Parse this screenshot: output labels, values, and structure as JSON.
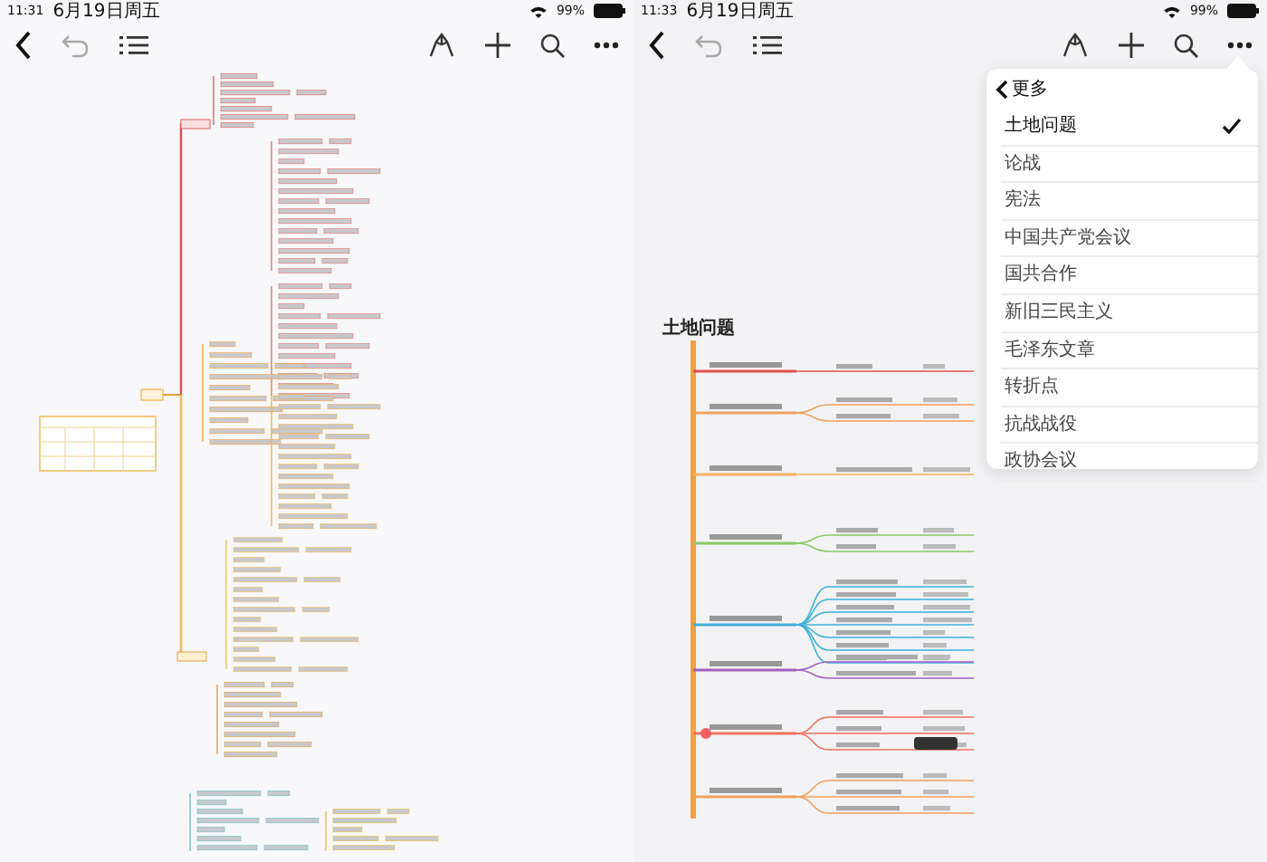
{
  "panes": [
    {
      "status_bar": {
        "time": "11:31",
        "date": "6月19日周五",
        "battery": "99%"
      }
    },
    {
      "status_bar": {
        "time": "11:33",
        "date": "6月19日周五",
        "battery": "99%"
      }
    }
  ],
  "mindmap": {
    "root": "土地问题"
  },
  "menu": {
    "title": "更多",
    "items": [
      {
        "label": "土地问题",
        "selected": true
      },
      {
        "label": "论战",
        "selected": false
      },
      {
        "label": "宪法",
        "selected": false
      },
      {
        "label": "中国共产党会议",
        "selected": false
      },
      {
        "label": "国共合作",
        "selected": false
      },
      {
        "label": "新旧三民主义",
        "selected": false
      },
      {
        "label": "毛泽东文章",
        "selected": false
      },
      {
        "label": "转折点",
        "selected": false
      },
      {
        "label": "抗战战役",
        "selected": false
      },
      {
        "label": "政协会议",
        "selected": false
      }
    ]
  }
}
